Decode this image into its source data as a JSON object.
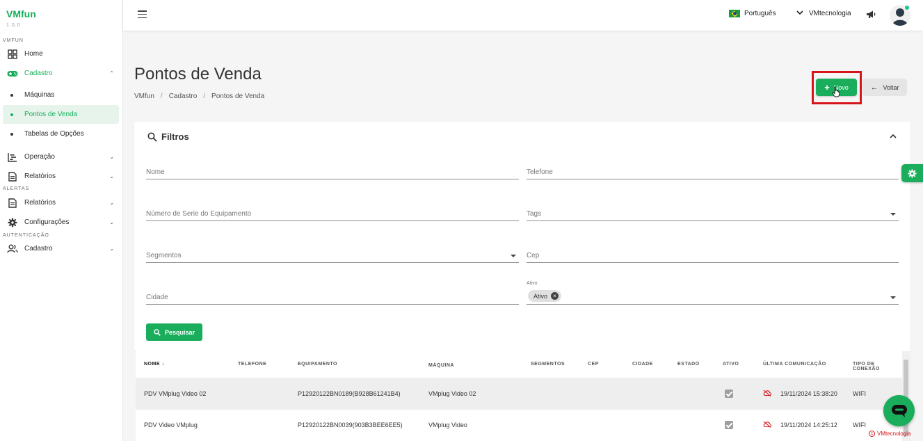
{
  "app": {
    "name": "VMfun",
    "version": "1.0.0"
  },
  "sidebar": {
    "sections": {
      "vmfun": "VMFUN",
      "alertas": "ALERTAS",
      "autenticacao": "AUTENTICAÇÃO"
    },
    "home": "Home",
    "cadastro": "Cadastro",
    "cadastro_sub": [
      "Máquinas",
      "Pontos de Venda",
      "Tabelas de Opções"
    ],
    "operacao": "Operação",
    "relatorios": "Relatórios",
    "alertas_relatorios": "Relatórios",
    "configuracoes": "Configurações",
    "auth_cadastro": "Cadastro"
  },
  "topbar": {
    "language": "Português",
    "company": "VMtecnologia"
  },
  "page": {
    "title": "Pontos de Venda",
    "breadcrumb": [
      "VMfun",
      "Cadastro",
      "Pontos de Venda"
    ],
    "btn_novo": "Novo",
    "btn_voltar": "Voltar"
  },
  "filters": {
    "title": "Filtros",
    "nome": "Nome",
    "telefone": "Telefone",
    "numero_serie": "Número de Serie do Equipamento",
    "tags": "Tags",
    "segmentos": "Segmentos",
    "cep": "Cep",
    "cidade": "Cidade",
    "ativo_label": "Ativo",
    "ativo_chip": "Ativo",
    "btn_pesquisar": "Pesquisar"
  },
  "table": {
    "headers": [
      "NOME",
      "TELEFONE",
      "EQUIPAMENTO",
      "MÁQUINA",
      "SEGMENTOS",
      "CEP",
      "CIDADE",
      "ESTADO",
      "ATIVO",
      "ÚLTIMA COMUNICAÇÃO",
      "TIPO DE CONEXÃO"
    ],
    "rows": [
      {
        "nome": "PDV VMplug Video 02",
        "telefone": "",
        "equipamento": "P12920122BN0189(B928B61241B4)",
        "maquina": "VMplug Video 02",
        "ativo": true,
        "ultima": "19/11/2024 15:38:20",
        "conexao": "WIFI"
      },
      {
        "nome": "PDV Video VMplug",
        "telefone": "",
        "equipamento": "P12920122BN0039(903B3BEE6EE5)",
        "maquina": "VMplug Video",
        "ativo": true,
        "ultima": "19/11/2024 14:25:12",
        "conexao": "WIFI"
      }
    ]
  },
  "footer": {
    "brand": "VMtecnologia"
  },
  "colors": {
    "primary": "#1aae5c",
    "highlight": "#d8141b"
  }
}
